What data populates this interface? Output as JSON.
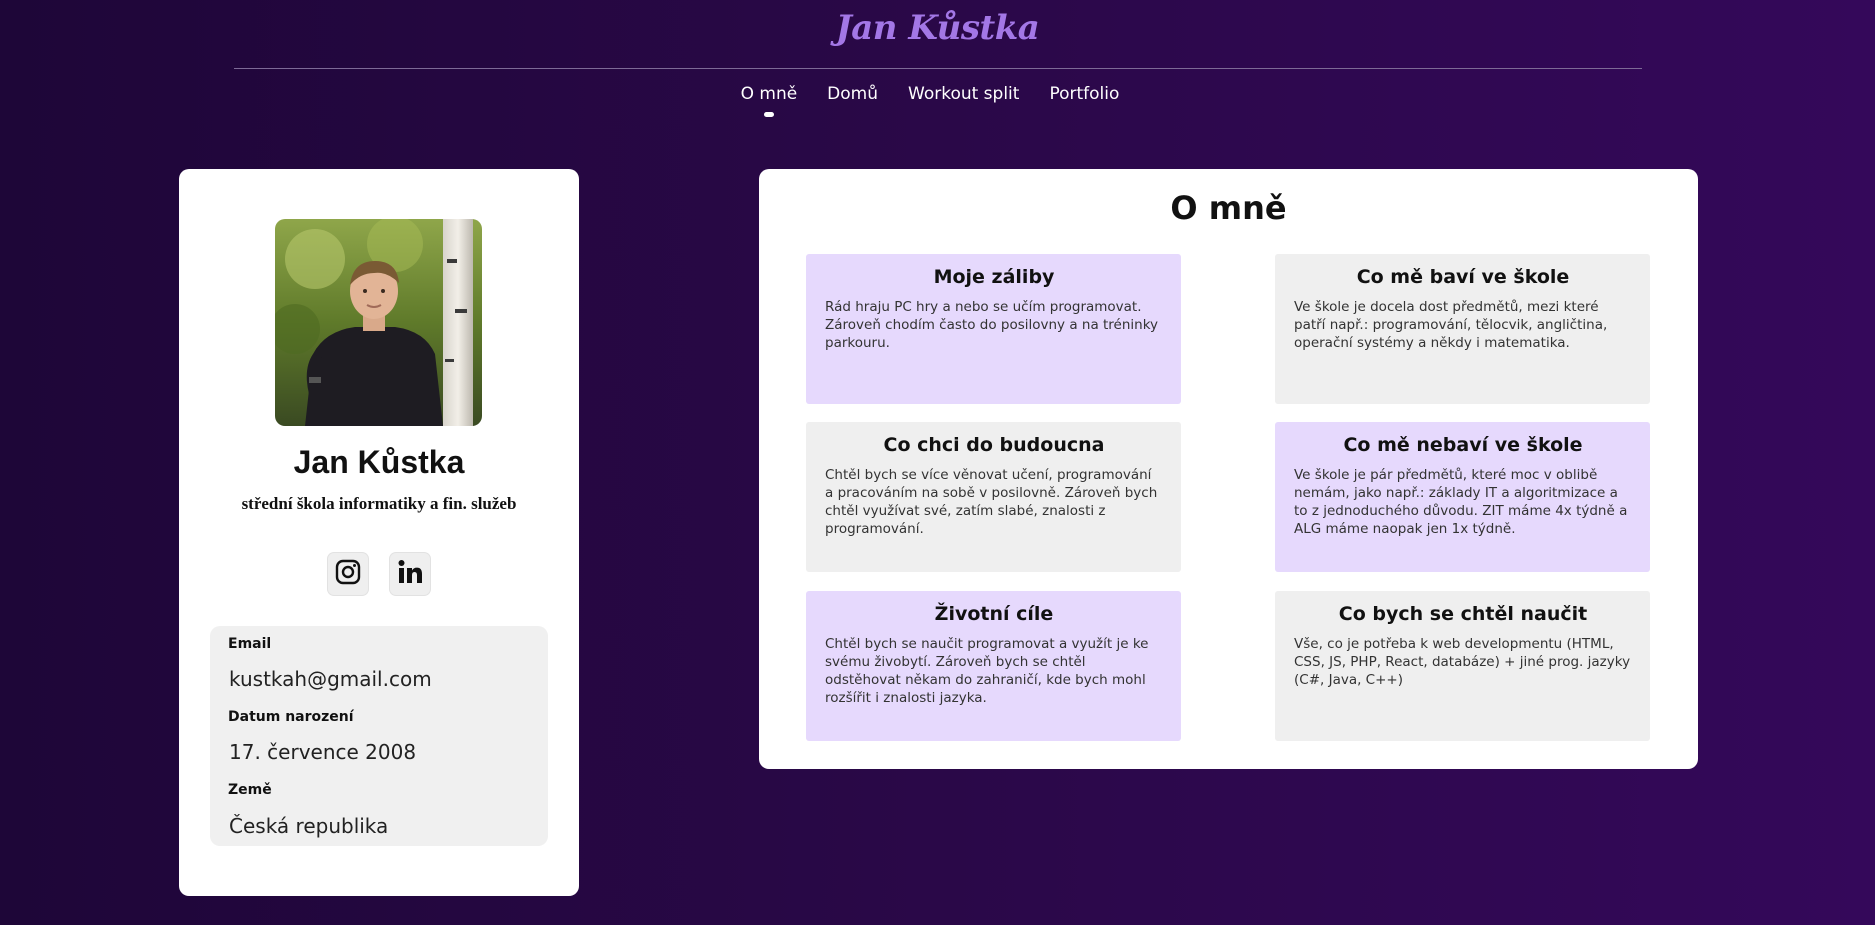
{
  "header": {
    "site_title": "Jan Kůstka",
    "nav": [
      {
        "label": "O mně",
        "active": true
      },
      {
        "label": "Domů",
        "active": false
      },
      {
        "label": "Workout split",
        "active": false
      },
      {
        "label": "Portfolio",
        "active": false
      }
    ]
  },
  "profile": {
    "name": "Jan Kůstka",
    "school": "střední škola informatiky a fin. služeb",
    "social": [
      {
        "icon": "instagram-icon"
      },
      {
        "icon": "linkedin-icon"
      }
    ],
    "info": [
      {
        "label": "Email",
        "value": "kustkah@gmail.com"
      },
      {
        "label": "Datum narození",
        "value": "17. července 2008"
      },
      {
        "label": "Země",
        "value": "Česká republika"
      }
    ]
  },
  "about": {
    "title": "O mně",
    "tiles": [
      {
        "title": "Moje záliby",
        "text": "Rád hraju PC hry a nebo se učím programovat. Zároveň chodím často do posilovny a na tréninky parkouru.",
        "color": "#e6d9fd"
      },
      {
        "title": "Co mě baví ve škole",
        "text": "Ve škole je docela dost předmětů, mezi které patří např.: programování, tělocvik, angličtina, operační systémy a někdy i matematika.",
        "color": "#efefef"
      },
      {
        "title": "Co chci do budoucna",
        "text": "Chtěl bych se více věnovat učení, programování a pracováním na sobě v posilovně. Zároveň bych chtěl využívat své, zatím slabé, znalosti z programování.",
        "color": "#efefef"
      },
      {
        "title": "Co mě nebaví ve škole",
        "text": "Ve škole je pár předmětů, které moc v oblibě nemám, jako např.: základy IT a algoritmizace a to z jednoduchého důvodu. ZIT máme 4x týdně a ALG máme naopak jen 1x týdně.",
        "color": "#e6d9fd"
      },
      {
        "title": "Životní cíle",
        "text": "Chtěl bych se naučit programovat a využít je ke svému živobytí. Zároveň bych se chtěl odstěhovat někam do zahraničí, kde bych mohl rozšířit i znalosti jazyka.",
        "color": "#e6d9fd"
      },
      {
        "title": "Co bych se chtěl naučit",
        "text": "Vše, co je potřeba k web developmentu (HTML, CSS, JS, PHP, React, databáze) + jiné prog. jazyky (C#, Java, C++)",
        "color": "#efefef"
      }
    ]
  },
  "colors": {
    "accent_title": "#a377e6",
    "tile_purple": "#e6d9fd",
    "tile_gray": "#efefef",
    "background_dark": "#1e0638"
  }
}
